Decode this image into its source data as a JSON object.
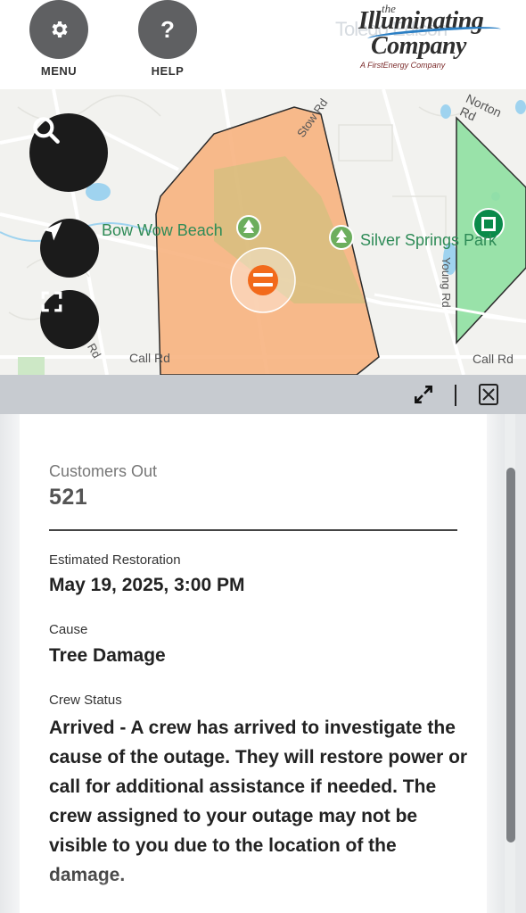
{
  "header": {
    "menu_label": "MENU",
    "help_label": "HELP",
    "help_glyph": "?",
    "logo": {
      "small": "the",
      "line1": "Illuminating",
      "line2": "Company",
      "ghost": "Toledo Edison",
      "tagline": "A FirstEnergy Company"
    }
  },
  "map": {
    "labels": {
      "bow_wow_beach": "Bow Wow Beach",
      "silver_springs_park": "Silver Springs Park",
      "stow_rd": "Stow Rd",
      "norton_rd": "Norton Rd",
      "young_rd": "Young Rd",
      "call_rd_left": "Call Rd",
      "call_rd_right": "Call Rd",
      "rd_left": "Rd"
    },
    "colors": {
      "outage_orange": "#f7b07c",
      "outage_green": "#8fe0a1",
      "marker_orange": "#f26a1b"
    }
  },
  "panel": {
    "customers_out_label": "Customers Out",
    "customers_out_value": "521",
    "estimated_restoration_label": "Estimated Restoration",
    "estimated_restoration_value": "May 19, 2025, 3:00 PM",
    "cause_label": "Cause",
    "cause_value": "Tree Damage",
    "crew_status_label": "Crew Status",
    "crew_status_value": "Arrived - A crew has arrived to investigate the cause of the outage. They will restore power or call for additional assistance if needed. The crew assigned to your outage may not be visible to you due to the location of the damage."
  },
  "icons": [
    "gear-icon",
    "question-icon",
    "search-icon",
    "locate-arrow-icon",
    "fullscreen-icon",
    "expand-icon",
    "close-icon",
    "tree-icon",
    "outage-marker-icon",
    "green-outage-marker-icon"
  ]
}
